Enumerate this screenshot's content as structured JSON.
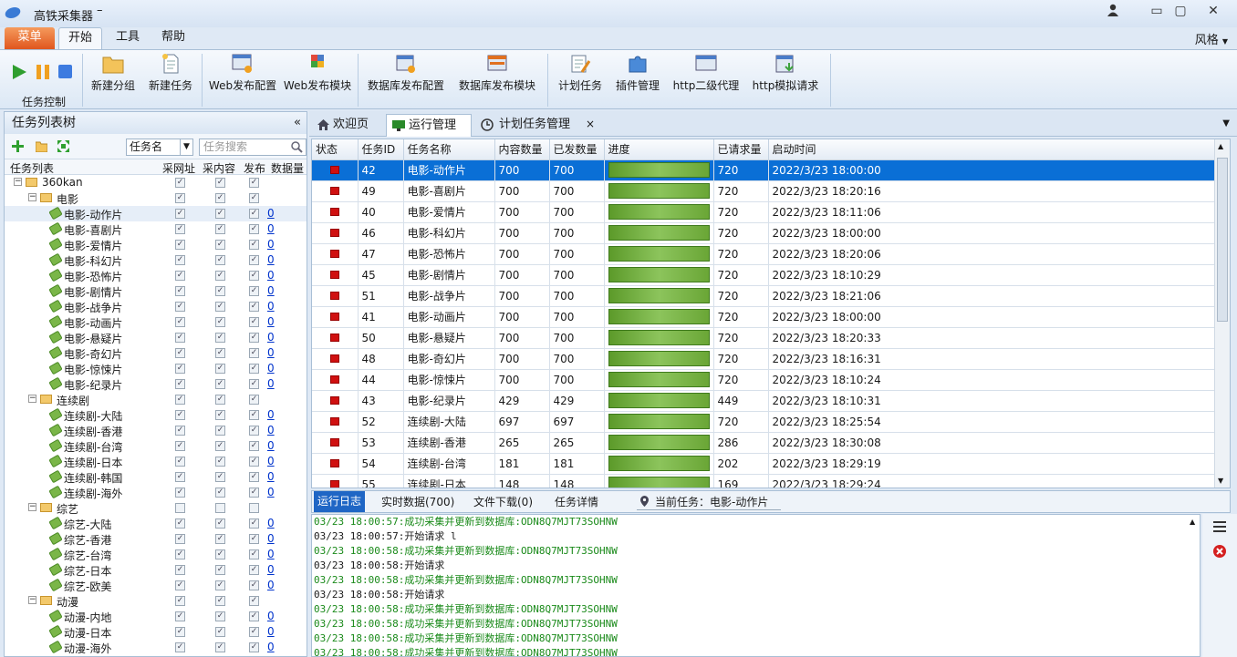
{
  "window": {
    "title": "高铁采集器",
    "title_suffix": "–",
    "controls": [
      "user",
      "minimize",
      "maximize",
      "close"
    ]
  },
  "menubar": {
    "menu": "菜单",
    "tabs": [
      "开始",
      "工具",
      "帮助"
    ],
    "active_tab": "开始",
    "style": "风格"
  },
  "ribbon": {
    "control_group": "任务控制",
    "buttons": [
      "新建分组",
      "新建任务",
      "Web发布配置",
      "Web发布模块",
      "数据库发布配置",
      "数据库发布模块",
      "计划任务",
      "插件管理",
      "http二级代理",
      "http模拟请求"
    ]
  },
  "left": {
    "title": "任务列表树",
    "collapse": "«",
    "filter_select": "任务名",
    "search_placeholder": "任务搜索",
    "columns": [
      "任务列表",
      "采网址",
      "采内容",
      "发布",
      "数据量"
    ],
    "rows": [
      {
        "t": "g",
        "label": "360kan",
        "lv": 0
      },
      {
        "t": "g",
        "label": "电影",
        "lv": 1
      },
      {
        "t": "i",
        "label": "电影-动作片",
        "lv": 2,
        "n": "0",
        "sel": true
      },
      {
        "t": "i",
        "label": "电影-喜剧片",
        "lv": 2,
        "n": "0"
      },
      {
        "t": "i",
        "label": "电影-爱情片",
        "lv": 2,
        "n": "0"
      },
      {
        "t": "i",
        "label": "电影-科幻片",
        "lv": 2,
        "n": "0"
      },
      {
        "t": "i",
        "label": "电影-恐怖片",
        "lv": 2,
        "n": "0"
      },
      {
        "t": "i",
        "label": "电影-剧情片",
        "lv": 2,
        "n": "0"
      },
      {
        "t": "i",
        "label": "电影-战争片",
        "lv": 2,
        "n": "0"
      },
      {
        "t": "i",
        "label": "电影-动画片",
        "lv": 2,
        "n": "0"
      },
      {
        "t": "i",
        "label": "电影-悬疑片",
        "lv": 2,
        "n": "0"
      },
      {
        "t": "i",
        "label": "电影-奇幻片",
        "lv": 2,
        "n": "0"
      },
      {
        "t": "i",
        "label": "电影-惊悚片",
        "lv": 2,
        "n": "0"
      },
      {
        "t": "i",
        "label": "电影-纪录片",
        "lv": 2,
        "n": "0"
      },
      {
        "t": "g",
        "label": "连续剧",
        "lv": 1
      },
      {
        "t": "i",
        "label": "连续剧-大陆",
        "lv": 2,
        "n": "0"
      },
      {
        "t": "i",
        "label": "连续剧-香港",
        "lv": 2,
        "n": "0"
      },
      {
        "t": "i",
        "label": "连续剧-台湾",
        "lv": 2,
        "n": "0"
      },
      {
        "t": "i",
        "label": "连续剧-日本",
        "lv": 2,
        "n": "0"
      },
      {
        "t": "i",
        "label": "连续剧-韩国",
        "lv": 2,
        "n": "0"
      },
      {
        "t": "i",
        "label": "连续剧-海外",
        "lv": 2,
        "n": "0"
      },
      {
        "t": "g",
        "label": "综艺",
        "lv": 1,
        "unchecked": true
      },
      {
        "t": "i",
        "label": "综艺-大陆",
        "lv": 2,
        "n": "0"
      },
      {
        "t": "i",
        "label": "综艺-香港",
        "lv": 2,
        "n": "0"
      },
      {
        "t": "i",
        "label": "综艺-台湾",
        "lv": 2,
        "n": "0"
      },
      {
        "t": "i",
        "label": "综艺-日本",
        "lv": 2,
        "n": "0"
      },
      {
        "t": "i",
        "label": "综艺-欧美",
        "lv": 2,
        "n": "0"
      },
      {
        "t": "g",
        "label": "动漫",
        "lv": 1
      },
      {
        "t": "i",
        "label": "动漫-内地",
        "lv": 2,
        "n": "0"
      },
      {
        "t": "i",
        "label": "动漫-日本",
        "lv": 2,
        "n": "0"
      },
      {
        "t": "i",
        "label": "动漫-海外",
        "lv": 2,
        "n": "0"
      }
    ]
  },
  "doc_tabs": [
    "欢迎页",
    "运行管理",
    "计划任务管理"
  ],
  "doc_tab_close": "×",
  "grid": {
    "columns": [
      "状态",
      "任务ID",
      "任务名称",
      "内容数量",
      "已发数量",
      "进度",
      "已请求量",
      "启动时间"
    ],
    "rows": [
      [
        "42",
        "电影-动作片",
        "700",
        "700",
        "720",
        "2022/3/23 18:00:00"
      ],
      [
        "49",
        "电影-喜剧片",
        "700",
        "700",
        "720",
        "2022/3/23 18:20:16"
      ],
      [
        "40",
        "电影-爱情片",
        "700",
        "700",
        "720",
        "2022/3/23 18:11:06"
      ],
      [
        "46",
        "电影-科幻片",
        "700",
        "700",
        "720",
        "2022/3/23 18:00:00"
      ],
      [
        "47",
        "电影-恐怖片",
        "700",
        "700",
        "720",
        "2022/3/23 18:20:06"
      ],
      [
        "45",
        "电影-剧情片",
        "700",
        "700",
        "720",
        "2022/3/23 18:10:29"
      ],
      [
        "51",
        "电影-战争片",
        "700",
        "700",
        "720",
        "2022/3/23 18:21:06"
      ],
      [
        "41",
        "电影-动画片",
        "700",
        "700",
        "720",
        "2022/3/23 18:00:00"
      ],
      [
        "50",
        "电影-悬疑片",
        "700",
        "700",
        "720",
        "2022/3/23 18:20:33"
      ],
      [
        "48",
        "电影-奇幻片",
        "700",
        "700",
        "720",
        "2022/3/23 18:16:31"
      ],
      [
        "44",
        "电影-惊悚片",
        "700",
        "700",
        "720",
        "2022/3/23 18:10:24"
      ],
      [
        "43",
        "电影-纪录片",
        "429",
        "429",
        "449",
        "2022/3/23 18:10:31"
      ],
      [
        "52",
        "连续剧-大陆",
        "697",
        "697",
        "720",
        "2022/3/23 18:25:54"
      ],
      [
        "53",
        "连续剧-香港",
        "265",
        "265",
        "286",
        "2022/3/23 18:30:08"
      ],
      [
        "54",
        "连续剧-台湾",
        "181",
        "181",
        "202",
        "2022/3/23 18:29:19"
      ],
      [
        "55",
        "连续剧-日本",
        "148",
        "148",
        "169",
        "2022/3/23 18:29:24"
      ]
    ]
  },
  "log": {
    "tabs": [
      "运行日志",
      "实时数据(700)",
      "文件下载(0)",
      "任务详情"
    ],
    "current_task": "当前任务：电影-动作片",
    "lines": [
      {
        "ok": true,
        "text": "03/23 18:00:57:成功采集并更新到数据库:ODN8Q7MJT73SOHNW"
      },
      {
        "ok": false,
        "text": "03/23 18:00:57:开始请求 l"
      },
      {
        "ok": true,
        "text": "03/23 18:00:58:成功采集并更新到数据库:ODN8Q7MJT73SOHNW"
      },
      {
        "ok": false,
        "text": "03/23 18:00:58:开始请求"
      },
      {
        "ok": true,
        "text": "03/23 18:00:58:成功采集并更新到数据库:ODN8Q7MJT73SOHNW"
      },
      {
        "ok": false,
        "text": "03/23 18:00:58:开始请求"
      },
      {
        "ok": true,
        "text": "03/23 18:00:58:成功采集并更新到数据库:ODN8Q7MJT73SOHNW"
      },
      {
        "ok": true,
        "text": "03/23 18:00:58:成功采集并更新到数据库:ODN8Q7MJT73SOHNW"
      },
      {
        "ok": true,
        "text": "03/23 18:00:58:成功采集并更新到数据库:ODN8Q7MJT73SOHNW"
      },
      {
        "ok": true,
        "text": "03/23 18:00:58:成功采集并更新到数据库:ODN8Q7MJT73SOHNW"
      }
    ]
  },
  "colors": {
    "accent": "#0a6fd6",
    "menu_orange": "#e0561e",
    "ok_green": "#1a8a1a",
    "status_red": "#d01010"
  }
}
